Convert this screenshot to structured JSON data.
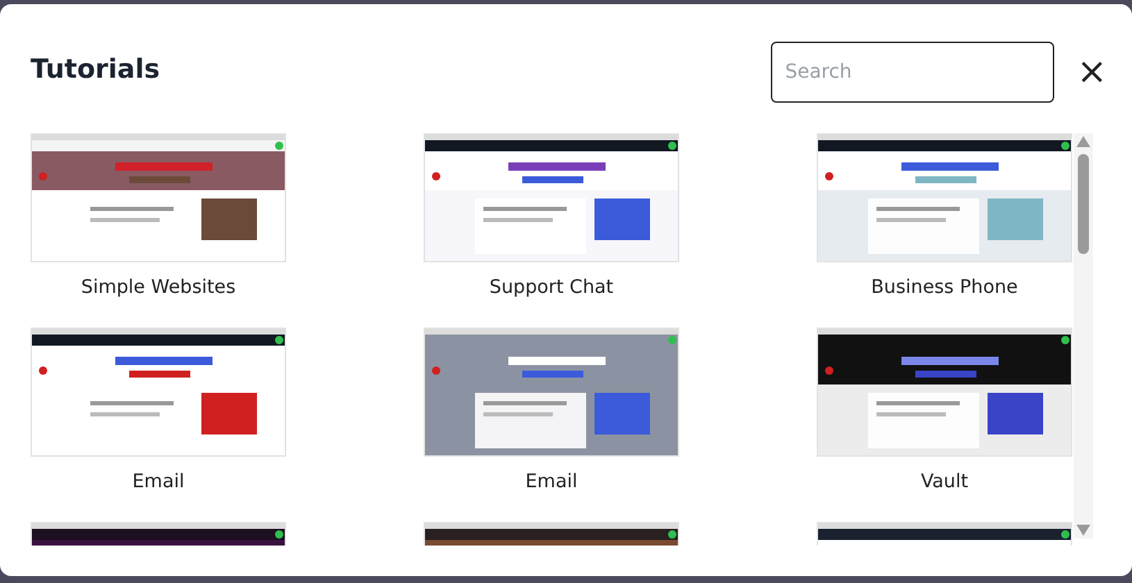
{
  "dialog": {
    "title": "Tutorials",
    "search": {
      "placeholder": "Search"
    },
    "close": "×"
  },
  "tutorials": [
    {
      "title": "Simple Websites",
      "thumbnail": {
        "kind": "picture"
      }
    },
    {
      "title": "Support Chat",
      "thumbnail": {
        "kind": "picture"
      }
    },
    {
      "title": "Business Phone",
      "thumbnail": {
        "kind": "picture"
      }
    },
    {
      "title": "Email",
      "thumbnail": {
        "kind": "picture"
      }
    },
    {
      "title": "Email",
      "thumbnail": {
        "kind": "picture"
      }
    },
    {
      "title": "Vault",
      "thumbnail": {
        "kind": "picture"
      }
    },
    {
      "thumbnail": {
        "kind": "picture"
      }
    },
    {
      "thumbnail": {
        "kind": "picture"
      }
    },
    {
      "thumbnail": {
        "kind": "picture"
      }
    }
  ]
}
